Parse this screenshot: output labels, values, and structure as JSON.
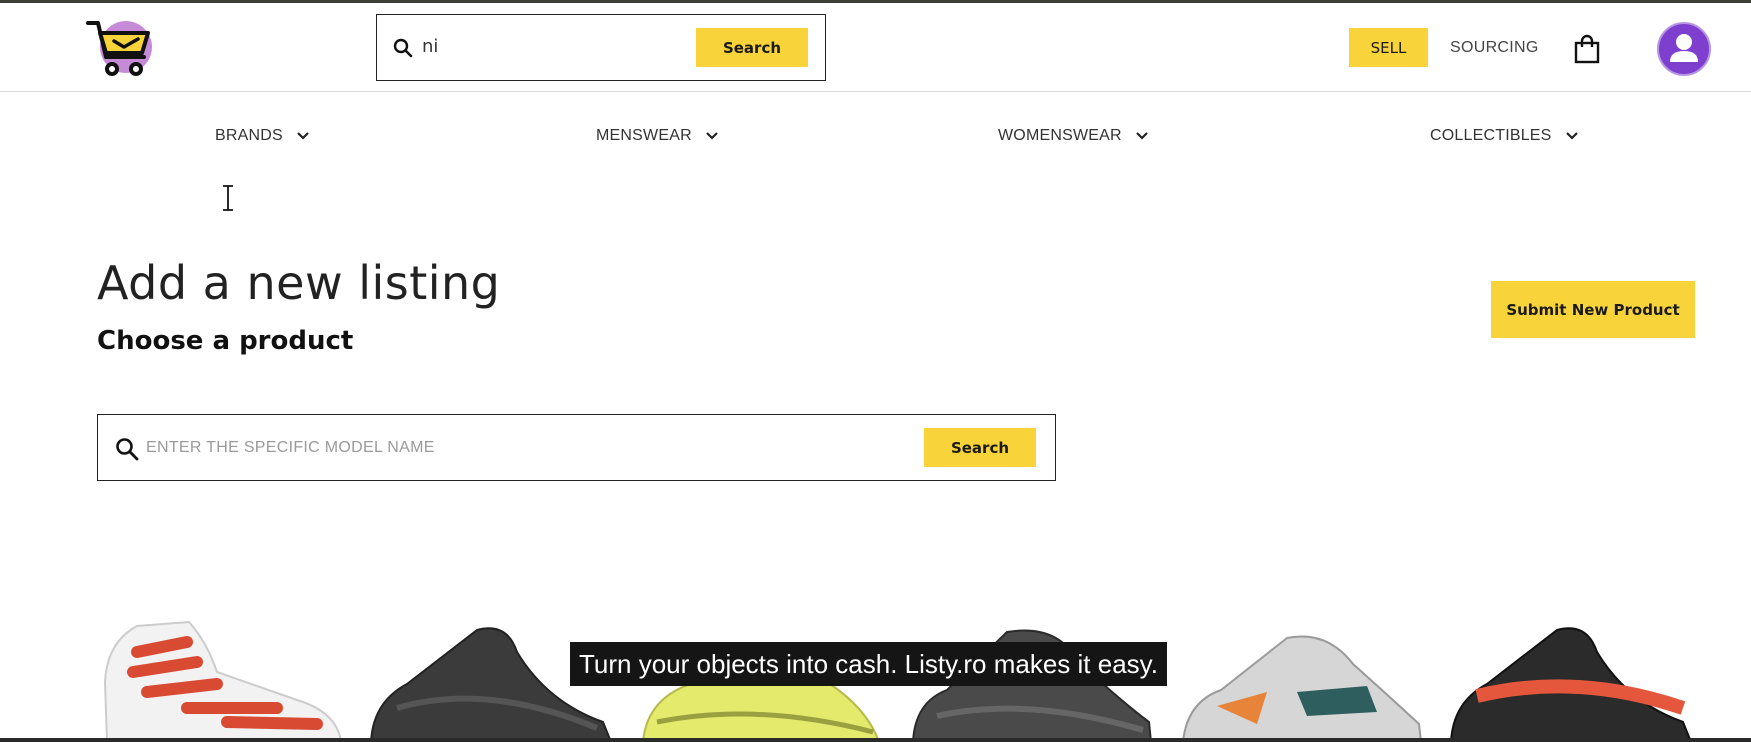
{
  "header": {
    "search": {
      "value": "ni",
      "button_label": "Search"
    },
    "sell_label": "SELL",
    "sourcing_label": "SOURCING"
  },
  "nav": {
    "items": [
      {
        "label": "BRANDS"
      },
      {
        "label": "MENSWEAR"
      },
      {
        "label": "WOMENSWEAR"
      },
      {
        "label": "COLLECTIBLES"
      }
    ]
  },
  "main": {
    "title": "Add a new listing",
    "subtitle": "Choose a product",
    "submit_label": "Submit New Product",
    "search": {
      "placeholder": "ENTER THE SPECIFIC MODEL NAME",
      "button_label": "Search"
    }
  },
  "caption": "Turn your objects into cash. Listy.ro makes it easy.",
  "colors": {
    "accent": "#f8d43a",
    "avatar": "#7e3fcf",
    "logo_circle": "#c58bd6"
  },
  "icons": [
    "cart-logo-icon",
    "search-icon",
    "shopping-bag-icon",
    "user-icon",
    "chevron-down-icon",
    "text-cursor-icon"
  ]
}
